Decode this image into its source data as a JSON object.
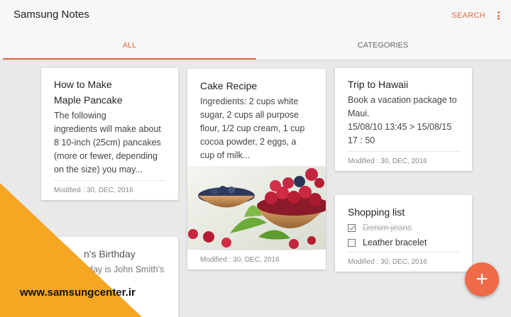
{
  "app": {
    "title": "Samsung Notes",
    "search_label": "SEARCH"
  },
  "tabs": [
    {
      "label": "ALL",
      "active": true
    },
    {
      "label": "CATEGORIES",
      "active": false
    }
  ],
  "notes": [
    {
      "title_line1": "How to Make",
      "title_line2": "Maple Pancake",
      "body": [
        "The following",
        "ingredients will make about",
        "8 10-inch (25cm) pancakes",
        "(more or fewer, depending",
        "on the size) you may..."
      ],
      "modified": "Modified : 30, DEC, 2016"
    },
    {
      "title": "Cake Recipe",
      "body": [
        "Ingredients: 2 cups white",
        "sugar, 2 cups all purpose",
        "flour, 1/2 cup cream, 1 cup",
        "cocoa powder, 2 eggs, a",
        "cup of milk..."
      ],
      "image": "raspberries-bowl-photo",
      "modified": "Modified : 30, DEC, 2016"
    },
    {
      "title": "Trip to Hawaii",
      "body": [
        "Book a vacation package to",
        "Maui.",
        "15/08/10 13:45 > 15/08/15",
        "17 : 50"
      ],
      "modified": "Modified : 30, DEC, 2016"
    },
    {
      "title": "Shopping list",
      "checklist": [
        {
          "text": "Denim jeans",
          "checked": true
        },
        {
          "text": "Leather bracelet",
          "checked": false
        }
      ],
      "modified": "Modified : 30, DEC, 2016"
    },
    {
      "title": "n's Birthday",
      "body": [
        "day is John Smith's"
      ]
    }
  ],
  "fab": {
    "icon": "plus-icon",
    "symbol": "+"
  },
  "watermark": {
    "text": "www.samsungcenter.ir",
    "color": "#f5a623"
  },
  "colors": {
    "accent": "#e06a45",
    "fab": "#ef6a47"
  }
}
